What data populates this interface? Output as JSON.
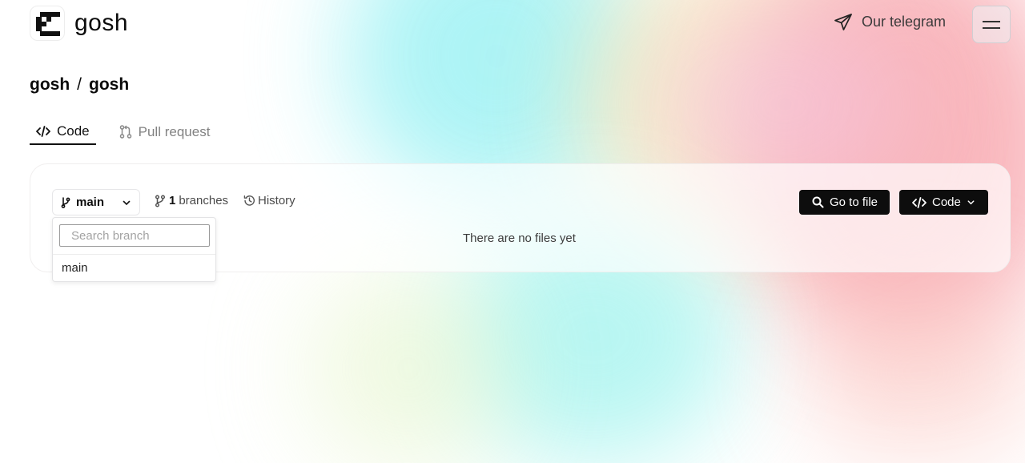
{
  "header": {
    "logo_text": "gosh",
    "telegram_label": "Our telegram"
  },
  "breadcrumb": {
    "owner": "gosh",
    "separator": "/",
    "repo": "gosh"
  },
  "tabs": [
    {
      "label": "Code",
      "active": true
    },
    {
      "label": "Pull request",
      "active": false
    }
  ],
  "toolbar": {
    "branch": "main",
    "branches_count": "1",
    "branches_label": "branches",
    "history_label": "History",
    "go_to_file_label": "Go to file",
    "code_label": "Code"
  },
  "dropdown": {
    "search_placeholder": "Search branch",
    "items": [
      "main"
    ]
  },
  "main": {
    "empty_message": "There are no files yet"
  },
  "icons": [
    "gosh-logo-icon",
    "send-icon",
    "menu-icon",
    "code-icon",
    "git-pull-request-icon",
    "git-branch-icon",
    "chevron-down-icon",
    "history-icon",
    "search-icon"
  ],
  "colors": {
    "dark_button": "#0d0d0d",
    "muted_text": "#828282"
  }
}
